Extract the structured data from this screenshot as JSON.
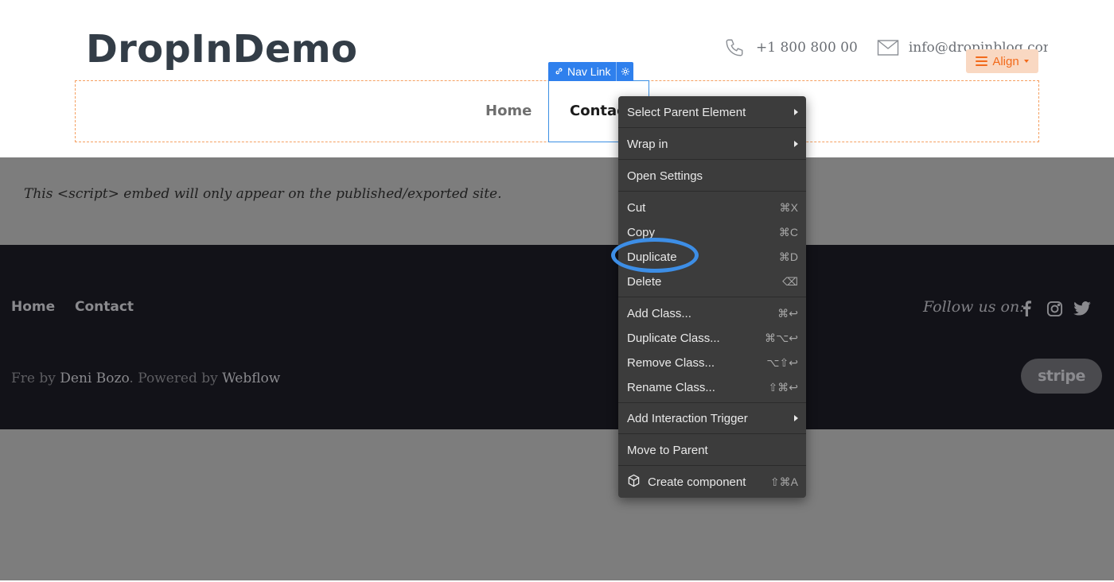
{
  "header": {
    "logo": "DropInDemo",
    "phone": "+1 800 800 00",
    "email": "info@dropinblog.com",
    "phone_icon": "phone-icon",
    "email_icon": "envelope-icon"
  },
  "designer": {
    "align_label": "Align",
    "nav_tag_label": "Nav Link",
    "selection_color": "#2f80ed",
    "container_outline_color": "#f5a061"
  },
  "nav": {
    "home": "Home",
    "contact": "Contact"
  },
  "embed": {
    "notice": "This <script> embed will only appear on the published/exported site."
  },
  "footer": {
    "links": [
      "Home",
      "Contact"
    ],
    "follow_label": "Follow us on:",
    "social_icons": [
      "facebook-icon",
      "instagram-icon",
      "twitter-icon"
    ],
    "credits_prefix": "Fre by ",
    "credits_author": "Deni Bozo",
    "credits_middle": ". Powered by ",
    "credits_platform": "Webflow",
    "stripe_label": "stripe"
  },
  "context_menu": {
    "items": [
      {
        "label": "Select Parent Element",
        "shortcut": "",
        "submenu": true
      },
      {
        "label": "Wrap in",
        "shortcut": "",
        "submenu": true
      },
      {
        "label": "Open Settings",
        "shortcut": "",
        "submenu": false
      },
      {
        "label": "Cut",
        "shortcut": "⌘X",
        "submenu": false
      },
      {
        "label": "Copy",
        "shortcut": "⌘C",
        "submenu": false
      },
      {
        "label": "Duplicate",
        "shortcut": "⌘D",
        "submenu": false
      },
      {
        "label": "Delete",
        "shortcut": "⌫",
        "submenu": false
      },
      {
        "label": "Add Class...",
        "shortcut": "⌘↩",
        "submenu": false
      },
      {
        "label": "Duplicate Class...",
        "shortcut": "⌘⌥↩",
        "submenu": false
      },
      {
        "label": "Remove Class...",
        "shortcut": "⌥⇧↩",
        "submenu": false
      },
      {
        "label": "Rename Class...",
        "shortcut": "⇧⌘↩",
        "submenu": false
      },
      {
        "label": "Add Interaction Trigger",
        "shortcut": "",
        "submenu": true
      },
      {
        "label": "Move to Parent",
        "shortcut": "",
        "submenu": false
      },
      {
        "label": "Create component",
        "shortcut": "⇧⌘A",
        "submenu": false,
        "icon": "cube-icon"
      }
    ],
    "highlighted_item": "Duplicate",
    "highlight_color": "#3d8ee6"
  }
}
